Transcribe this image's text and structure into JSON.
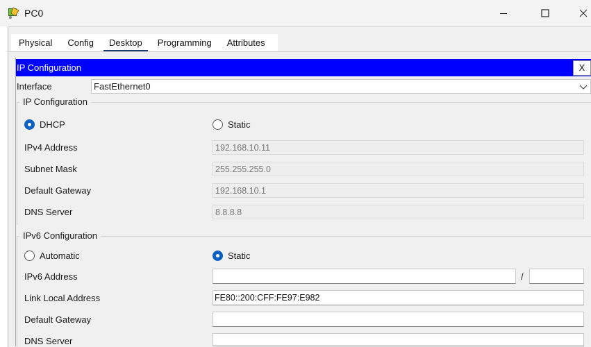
{
  "window": {
    "title": "PC0"
  },
  "tabs": [
    {
      "label": "Physical",
      "active": false
    },
    {
      "label": "Config",
      "active": false
    },
    {
      "label": "Desktop",
      "active": true
    },
    {
      "label": "Programming",
      "active": false
    },
    {
      "label": "Attributes",
      "active": false
    }
  ],
  "panel": {
    "title": "IP Configuration",
    "close_label": "X"
  },
  "interface": {
    "label": "Interface",
    "value": "FastEthernet0"
  },
  "ipv4": {
    "group_title": "IP Configuration",
    "dhcp_label": "DHCP",
    "static_label": "Static",
    "selected_mode": "DHCP",
    "fields": {
      "ipv4_address": {
        "label": "IPv4 Address",
        "value": "192.168.10.11"
      },
      "subnet_mask": {
        "label": "Subnet Mask",
        "value": "255.255.255.0"
      },
      "default_gateway": {
        "label": "Default Gateway",
        "value": "192.168.10.1"
      },
      "dns_server": {
        "label": "DNS Server",
        "value": "8.8.8.8"
      }
    }
  },
  "ipv6": {
    "group_title": "IPv6 Configuration",
    "automatic_label": "Automatic",
    "static_label": "Static",
    "selected_mode": "Static",
    "separator": "/",
    "fields": {
      "ipv6_address": {
        "label": "IPv6 Address",
        "value": "",
        "prefix": ""
      },
      "link_local": {
        "label": "Link Local Address",
        "value": "FE80::200:CFF:FE97:E982"
      },
      "default_gateway": {
        "label": "Default Gateway",
        "value": ""
      },
      "dns_server": {
        "label": "DNS Server",
        "value": ""
      }
    }
  },
  "colors": {
    "title_bar_blue": "#0000ff",
    "radio_selected": "#0a5fc4",
    "active_tab_underline": "#1e3a6e"
  }
}
